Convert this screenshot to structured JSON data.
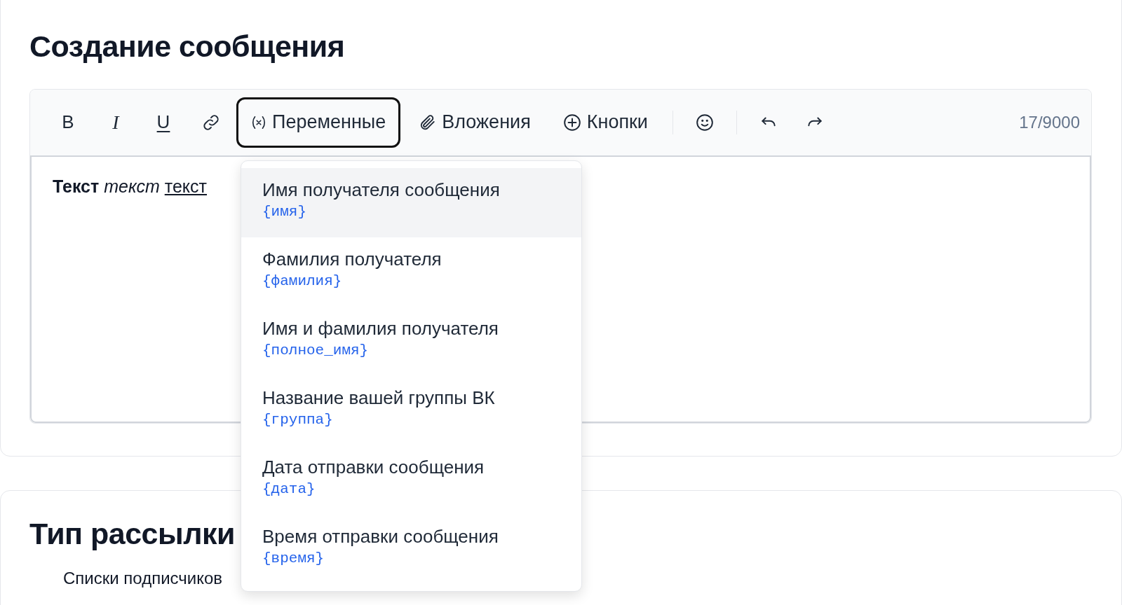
{
  "title": "Создание сообщения",
  "toolbar": {
    "format_buttons": [
      {
        "kind": "bold",
        "label": "B"
      },
      {
        "kind": "italic",
        "label": "I"
      },
      {
        "kind": "underline",
        "label": "U"
      },
      {
        "kind": "link"
      }
    ],
    "menu_buttons": [
      {
        "kind": "variable",
        "label": "Переменные",
        "selected": true
      },
      {
        "kind": "clip",
        "label": "Вложения",
        "selected": false
      },
      {
        "kind": "plus",
        "label": "Кнопки",
        "selected": false
      }
    ],
    "actions": [
      {
        "kind": "emoji"
      },
      {
        "kind": "undo"
      },
      {
        "kind": "redo"
      }
    ],
    "counter": "17/9000"
  },
  "editor": {
    "segments": [
      {
        "kind": "bold",
        "text": "Текст"
      },
      {
        "kind": "italic",
        "text": "текст"
      },
      {
        "kind": "underline",
        "text": "текст"
      }
    ]
  },
  "variables_menu": [
    {
      "label": "Имя получателя сообщения",
      "code": "{имя}",
      "highlighted": true
    },
    {
      "label": "Фамилия получателя",
      "code": "{фамилия}",
      "highlighted": false
    },
    {
      "label": "Имя и фамилия получателя",
      "code": "{полное_имя}",
      "highlighted": false
    },
    {
      "label": "Название вашей группы ВК",
      "code": "{группа}",
      "highlighted": false
    },
    {
      "label": "Дата отправки сообщения",
      "code": "{дата}",
      "highlighted": false
    },
    {
      "label": "Время отправки сообщения",
      "code": "{время}",
      "highlighted": false
    }
  ],
  "section2": {
    "title": "Тип рассылки",
    "subtitle": "Списки подписчиков"
  }
}
